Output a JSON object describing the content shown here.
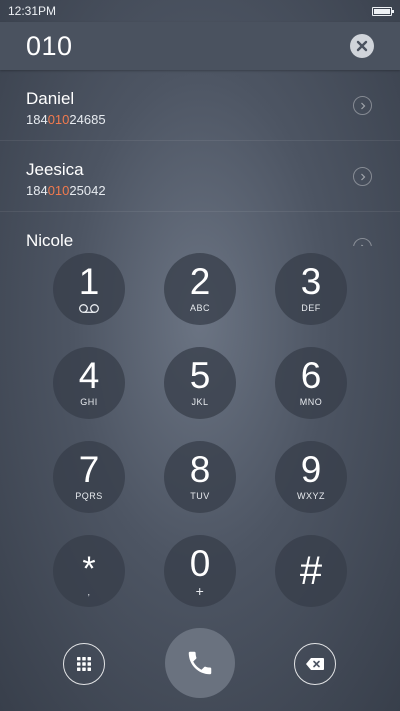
{
  "status_bar": {
    "time": "12:31PM"
  },
  "search": {
    "query": "010"
  },
  "results": [
    {
      "name": "Daniel",
      "number_pre": "184",
      "number_match": "010",
      "number_post": "24685"
    },
    {
      "name": "Jeesica",
      "number_pre": "184",
      "number_match": "010",
      "number_post": "25042"
    },
    {
      "name": "Nicole",
      "number_pre": "",
      "number_match": "",
      "number_post": ""
    }
  ],
  "keypad": [
    {
      "digit": "1",
      "letters": ""
    },
    {
      "digit": "2",
      "letters": "ABC"
    },
    {
      "digit": "3",
      "letters": "DEF"
    },
    {
      "digit": "4",
      "letters": "GHI"
    },
    {
      "digit": "5",
      "letters": "JKL"
    },
    {
      "digit": "6",
      "letters": "MNO"
    },
    {
      "digit": "7",
      "letters": "PQRS"
    },
    {
      "digit": "8",
      "letters": "TUV"
    },
    {
      "digit": "9",
      "letters": "WXYZ"
    },
    {
      "digit": "*",
      "letters": ","
    },
    {
      "digit": "0",
      "letters": "+"
    },
    {
      "digit": "#",
      "letters": ""
    }
  ],
  "icons": {
    "clear": "clear-icon",
    "voicemail": "voicemail-icon",
    "dialpad": "dialpad-icon",
    "call": "phone-icon",
    "backspace": "backspace-icon",
    "row_detail": "chevron-right-icon"
  },
  "colors": {
    "match_highlight": "#f27a4e",
    "header_bg": "#4a525f",
    "key_bg": "#373e4a"
  }
}
